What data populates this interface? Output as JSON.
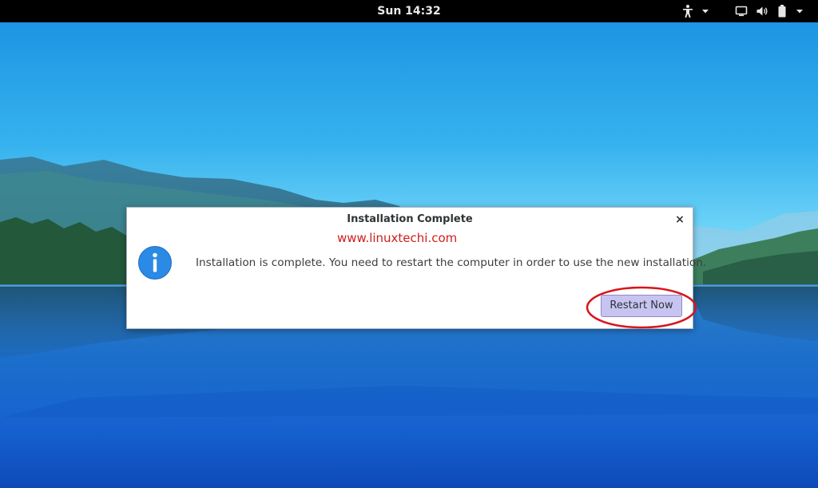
{
  "topbar": {
    "clock": "Sun 14:32",
    "icons": {
      "accessibility": "accessibility-icon",
      "dropdown": "chevron-down-icon",
      "screen": "display-icon",
      "volume": "volume-icon",
      "battery": "battery-icon"
    }
  },
  "desktop": {
    "wallpaper": "lake-mountains-wallpaper"
  },
  "dialog": {
    "title": "Installation Complete",
    "close_label": "×",
    "watermark": "www.linuxtechi.com",
    "icon": "info-icon",
    "message": "Installation is complete. You need to restart the computer in order to use the new installation.",
    "restart_label": "Restart Now"
  },
  "colors": {
    "topbar": "#000000",
    "watermark": "#d01c1c",
    "info_icon": "#2a8ae6",
    "button_highlight": "#c8c4f2",
    "annotation_ring": "#d9141b"
  }
}
